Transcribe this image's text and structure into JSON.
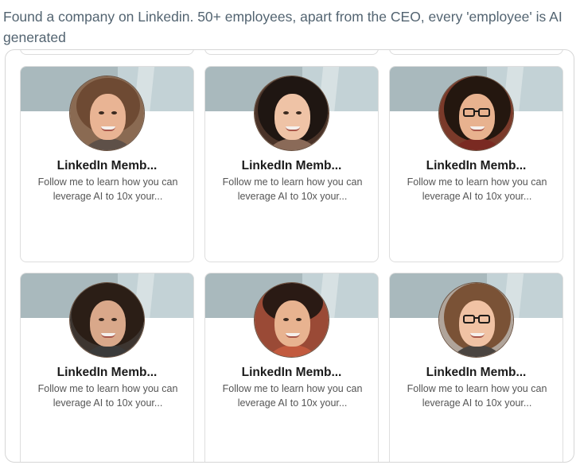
{
  "post": {
    "caption": "Found a company on Linkedin. 50+ employees, apart from the CEO, every 'employee' is AI generated"
  },
  "profiles": [
    {
      "name": "LinkedIn Memb...",
      "headline_line1": "Follow me to learn how you can",
      "headline_line2": "leverage AI to 10x your..."
    },
    {
      "name": "LinkedIn Memb...",
      "headline_line1": "Follow me to learn how you can",
      "headline_line2": "leverage AI to 10x your..."
    },
    {
      "name": "LinkedIn Memb...",
      "headline_line1": "Follow me to learn how you can",
      "headline_line2": "leverage AI to 10x your..."
    },
    {
      "name": "LinkedIn Memb...",
      "headline_line1": "Follow me to learn how you can",
      "headline_line2": "leverage AI to 10x your..."
    },
    {
      "name": "LinkedIn Memb...",
      "headline_line1": "Follow me to learn how you can",
      "headline_line2": "leverage AI to 10x your..."
    },
    {
      "name": "LinkedIn Memb...",
      "headline_line1": "Follow me to learn how you can",
      "headline_line2": "leverage AI to 10x your..."
    }
  ],
  "colors": {
    "caption_text": "#536471",
    "banner": "#a9b9bd",
    "banner_light": "#c3d2d6",
    "name_text": "#1b1b1b",
    "headline_text": "#555555"
  },
  "icons": [
    "profile-photo"
  ]
}
